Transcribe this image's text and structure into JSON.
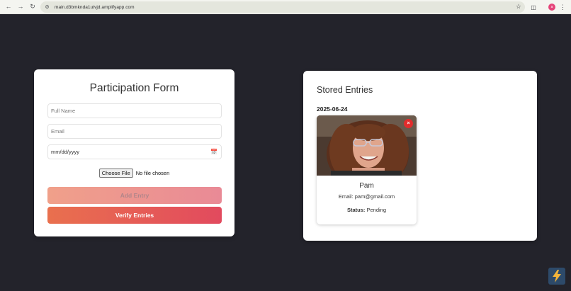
{
  "browser": {
    "url": "main.d3bmknda1utvjd.amplifyapp.com",
    "back_icon": "arrow-left-icon",
    "forward_icon": "arrow-right-icon",
    "reload_icon": "reload-icon",
    "avatar_letter": "a"
  },
  "form": {
    "title": "Participation Form",
    "full_name_placeholder": "Full Name",
    "email_placeholder": "Email",
    "date_placeholder": "mm/dd/yyyy",
    "choose_file_label": "Choose File",
    "file_status": "No file chosen",
    "add_entry_label": "Add Entry",
    "verify_entries_label": "Verify Entries"
  },
  "stored": {
    "title": "Stored Entries",
    "groups": [
      {
        "date": "2025-06-24",
        "entries": [
          {
            "name": "Pam",
            "email_label": "Email:",
            "email": "pam@gmail.com",
            "status_label": "Status:",
            "status": "Pending",
            "remove_label": "×"
          }
        ]
      }
    ]
  },
  "colors": {
    "page_background": "#23232b",
    "add_button_start": "#f0a08a",
    "verify_button_start": "#e9704e",
    "verify_button_end": "#e24a5e",
    "remove_button": "#e32c2c"
  }
}
